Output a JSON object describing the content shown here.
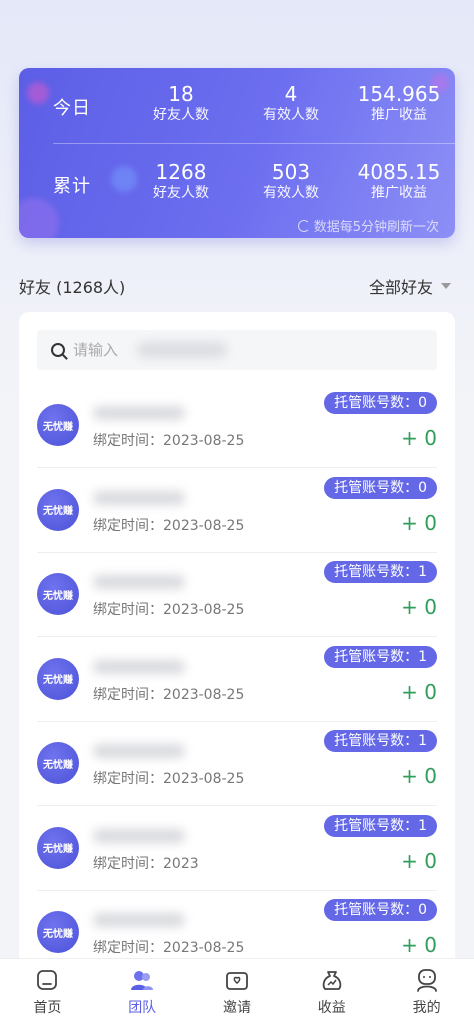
{
  "stats": {
    "today": {
      "label": "今日",
      "friends": {
        "value": "18",
        "label": "好友人数"
      },
      "effective": {
        "value": "4",
        "label": "有效人数"
      },
      "income": {
        "value": "154.965",
        "label": "推广收益"
      }
    },
    "total": {
      "label": "累计",
      "friends": {
        "value": "1268",
        "label": "好友人数"
      },
      "effective": {
        "value": "503",
        "label": "有效人数"
      },
      "income": {
        "value": "4085.15",
        "label": "推广收益"
      }
    },
    "refresh_note": "数据每5分钟刷新一次"
  },
  "friends": {
    "title": "好友 (1268人)",
    "filter": "全部好友",
    "search_placeholder": "请输入",
    "items": [
      {
        "avatar": "无忧赚",
        "bind_time": "绑定时间：2023-08-25",
        "badge": "托管账号数：0",
        "earning": "+ 0"
      },
      {
        "avatar": "无忧赚",
        "bind_time": "绑定时间：2023-08-25",
        "badge": "托管账号数：0",
        "earning": "+ 0"
      },
      {
        "avatar": "无忧赚",
        "bind_time": "绑定时间：2023-08-25",
        "badge": "托管账号数：1",
        "earning": "+ 0"
      },
      {
        "avatar": "无忧赚",
        "bind_time": "绑定时间：2023-08-25",
        "badge": "托管账号数：1",
        "earning": "+ 0"
      },
      {
        "avatar": "无忧赚",
        "bind_time": "绑定时间：2023-08-25",
        "badge": "托管账号数：1",
        "earning": "+ 0"
      },
      {
        "avatar": "无忧赚",
        "bind_time": "绑定时间：2023",
        "badge": "托管账号数：1",
        "earning": "+ 0"
      },
      {
        "avatar": "无忧赚",
        "bind_time": "绑定时间：2023-08-25",
        "badge": "托管账号数：0",
        "earning": "+ 0"
      }
    ]
  },
  "nav": {
    "items": [
      {
        "label": "首页",
        "icon": "home-icon"
      },
      {
        "label": "团队",
        "icon": "team-icon"
      },
      {
        "label": "邀请",
        "icon": "invite-icon"
      },
      {
        "label": "收益",
        "icon": "earnings-icon"
      },
      {
        "label": "我的",
        "icon": "profile-icon"
      }
    ],
    "active_index": 1,
    "active_color": "#5b5fe4"
  },
  "colors": {
    "accent": "#6468e6",
    "earning_green": "#2f9e5b"
  }
}
